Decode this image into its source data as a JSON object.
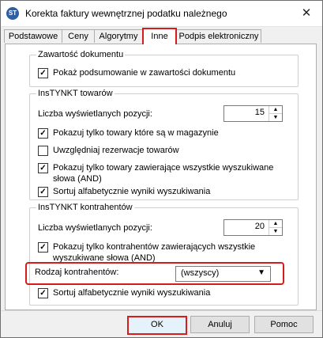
{
  "window": {
    "title": "Korekta faktury wewnętrznej podatku należnego",
    "icon": "app-logo-icon",
    "close_glyph": "✕"
  },
  "tabs": [
    {
      "label": "Podstawowe",
      "active": false
    },
    {
      "label": "Ceny",
      "active": false
    },
    {
      "label": "Algorytmy",
      "active": false
    },
    {
      "label": "Inne",
      "active": true
    },
    {
      "label": "Podpis elektroniczny",
      "active": false
    }
  ],
  "sections": {
    "document": {
      "title": "Zawartość dokumentu",
      "show_summary": {
        "label": "Pokaż podsumowanie w zawartości dokumentu",
        "checked": true
      }
    },
    "products": {
      "title": "InsTYNKT towarów",
      "count_label": "Liczba wyświetlanych pozycji:",
      "count_value": "15",
      "only_in_stock": {
        "label": "Pokazuj tylko towary które są w magazynie",
        "checked": true
      },
      "include_reservations": {
        "label": "Uwzględniaj rezerwacje towarów",
        "checked": false
      },
      "all_words": {
        "label": "Pokazuj tylko towary zawierające wszystkie wyszukiwane słowa (AND)",
        "checked": true
      },
      "sort_alpha": {
        "label": "Sortuj alfabetycznie wyniki wyszukiwania",
        "checked": true
      }
    },
    "contractors": {
      "title": "InsTYNKT kontrahentów",
      "count_label": "Liczba wyświetlanych pozycji:",
      "count_value": "20",
      "all_words": {
        "label": "Pokazuj tylko kontrahentów zawierających wszystkie wyszukiwane słowa (AND)",
        "checked": true
      },
      "type_label": "Rodzaj kontrahentów:",
      "type_value": "(wszyscy)",
      "sort_alpha": {
        "label": "Sortuj alfabetycznie wyniki wyszukiwania",
        "checked": true
      }
    }
  },
  "buttons": {
    "ok": "OK",
    "cancel": "Anuluj",
    "help": "Pomoc"
  },
  "glyphs": {
    "check": "✓",
    "up": "▲",
    "down": "▼"
  },
  "colors": {
    "highlight": "#d71c1c"
  }
}
